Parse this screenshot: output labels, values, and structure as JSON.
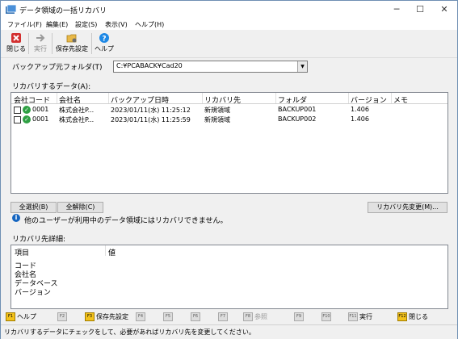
{
  "window": {
    "title": "データ領域の一括リカバリ",
    "min": "─",
    "max": "☐",
    "close": "✕"
  },
  "menu": [
    "ファイル(F)",
    "編集(E)",
    "設定(S)",
    "表示(V)",
    "ヘルプ(H)"
  ],
  "toolbar": {
    "close_label": "閉じる",
    "run_label": "実行",
    "save_dest_label": "保存先設定",
    "help_label": "ヘルプ"
  },
  "backup_folder": {
    "label": "バックアップ元フォルダ(T)",
    "value": "C:¥PCABACK¥Cad20"
  },
  "grid": {
    "label": "リカバリするデータ(A):",
    "columns": [
      "会社コード",
      "会社名",
      "バックアップ日時",
      "リカバリ先",
      "フォルダ",
      "バージョン",
      "メモ"
    ],
    "rows": [
      {
        "code": "0001",
        "name": "株式会社P...",
        "datetime": "2023/01/11(水) 11:25:12",
        "dest": "新規領域",
        "folder": "BACKUP001",
        "version": "1.406",
        "memo": ""
      },
      {
        "code": "0001",
        "name": "株式会社P...",
        "datetime": "2023/01/11(水) 11:25:59",
        "dest": "新規領域",
        "folder": "BACKUP002",
        "version": "1.406",
        "memo": ""
      }
    ]
  },
  "buttons": {
    "select_all": "全選択(B)",
    "deselect_all": "全解除(C)",
    "change_dest": "リカバリ先変更(M)..."
  },
  "info_message": "他のユーザーが利用中のデータ領域にはリカバリできません。",
  "detail": {
    "label": "リカバリ先詳細:",
    "col_item": "項目",
    "col_value": "値",
    "items": [
      "コード",
      "会社名",
      "データベース",
      "バージョン"
    ]
  },
  "fkeys": [
    {
      "key": "F1",
      "label": "ヘルプ",
      "active": true
    },
    {
      "key": "F2",
      "label": "",
      "active": false
    },
    {
      "key": "F3",
      "label": "保存先設定",
      "active": true
    },
    {
      "key": "F4",
      "label": "",
      "active": false
    },
    {
      "key": "F5",
      "label": "",
      "active": false
    },
    {
      "key": "F6",
      "label": "",
      "active": false
    },
    {
      "key": "F7",
      "label": "",
      "active": false
    },
    {
      "key": "F8",
      "label": "参照",
      "active": false
    },
    {
      "key": "F9",
      "label": "",
      "active": false
    },
    {
      "key": "F10",
      "label": "",
      "active": false
    },
    {
      "key": "F11",
      "label": "実行",
      "active": false
    },
    {
      "key": "F12",
      "label": "閉じる",
      "active": true
    }
  ],
  "status": "リカバリするデータにチェックをして、必要があればリカバリ先を変更してください。",
  "colors": {
    "accent": "#1565c0",
    "ok": "#2ea043",
    "fkey_active": "#f3c21b",
    "close_icon": "#d32f2f"
  }
}
